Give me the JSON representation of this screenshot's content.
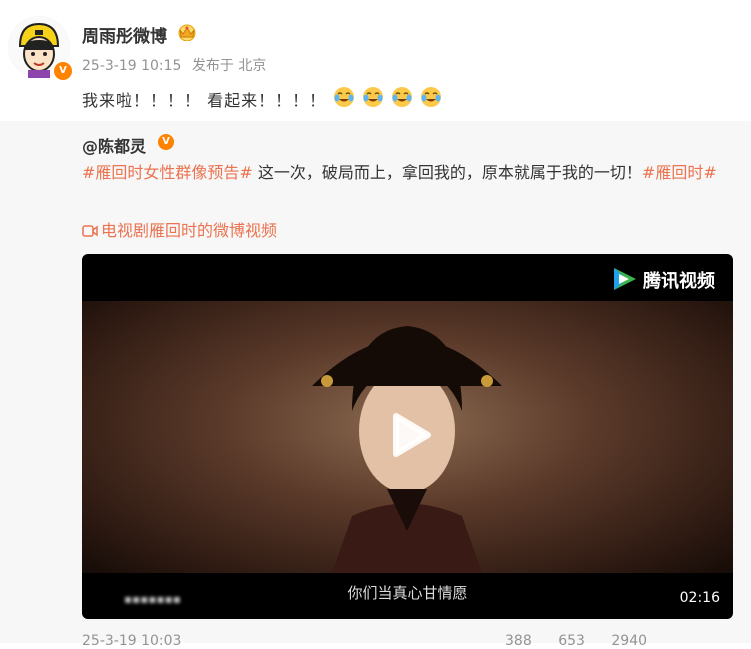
{
  "post": {
    "author": "周雨彤微博",
    "time": "25-3-19 10:15",
    "source": "发布于 北京",
    "text": "我来啦！！！！ 看起来！！！！",
    "emojis": [
      "crying-laugh-emoji",
      "crying-laugh-emoji",
      "crying-laugh-emoji",
      "crying-laugh-emoji"
    ]
  },
  "repost": {
    "author": "@陈都灵",
    "tag1": "#雁回时女性群像预告#",
    "body": " 这一次，破局而上，拿回我的，原本就属于我的一切！",
    "tag2": "#雁回时#",
    "video_link": "电视剧雁回时的微博视频",
    "video": {
      "brand": "腾讯视频",
      "subtitle": "你们当真心甘情愿",
      "duration": "02:16",
      "blurred_text": "▪▪▪▪▪▪▪"
    },
    "footer_time": "25-3-19 10:03",
    "actions": {
      "repost_count": "388",
      "comment_count": "653",
      "like_count": "2940"
    }
  },
  "colors": {
    "accent": "#eb7350",
    "badge": "#ff8200",
    "repost_bg": "#f7f7f7"
  }
}
